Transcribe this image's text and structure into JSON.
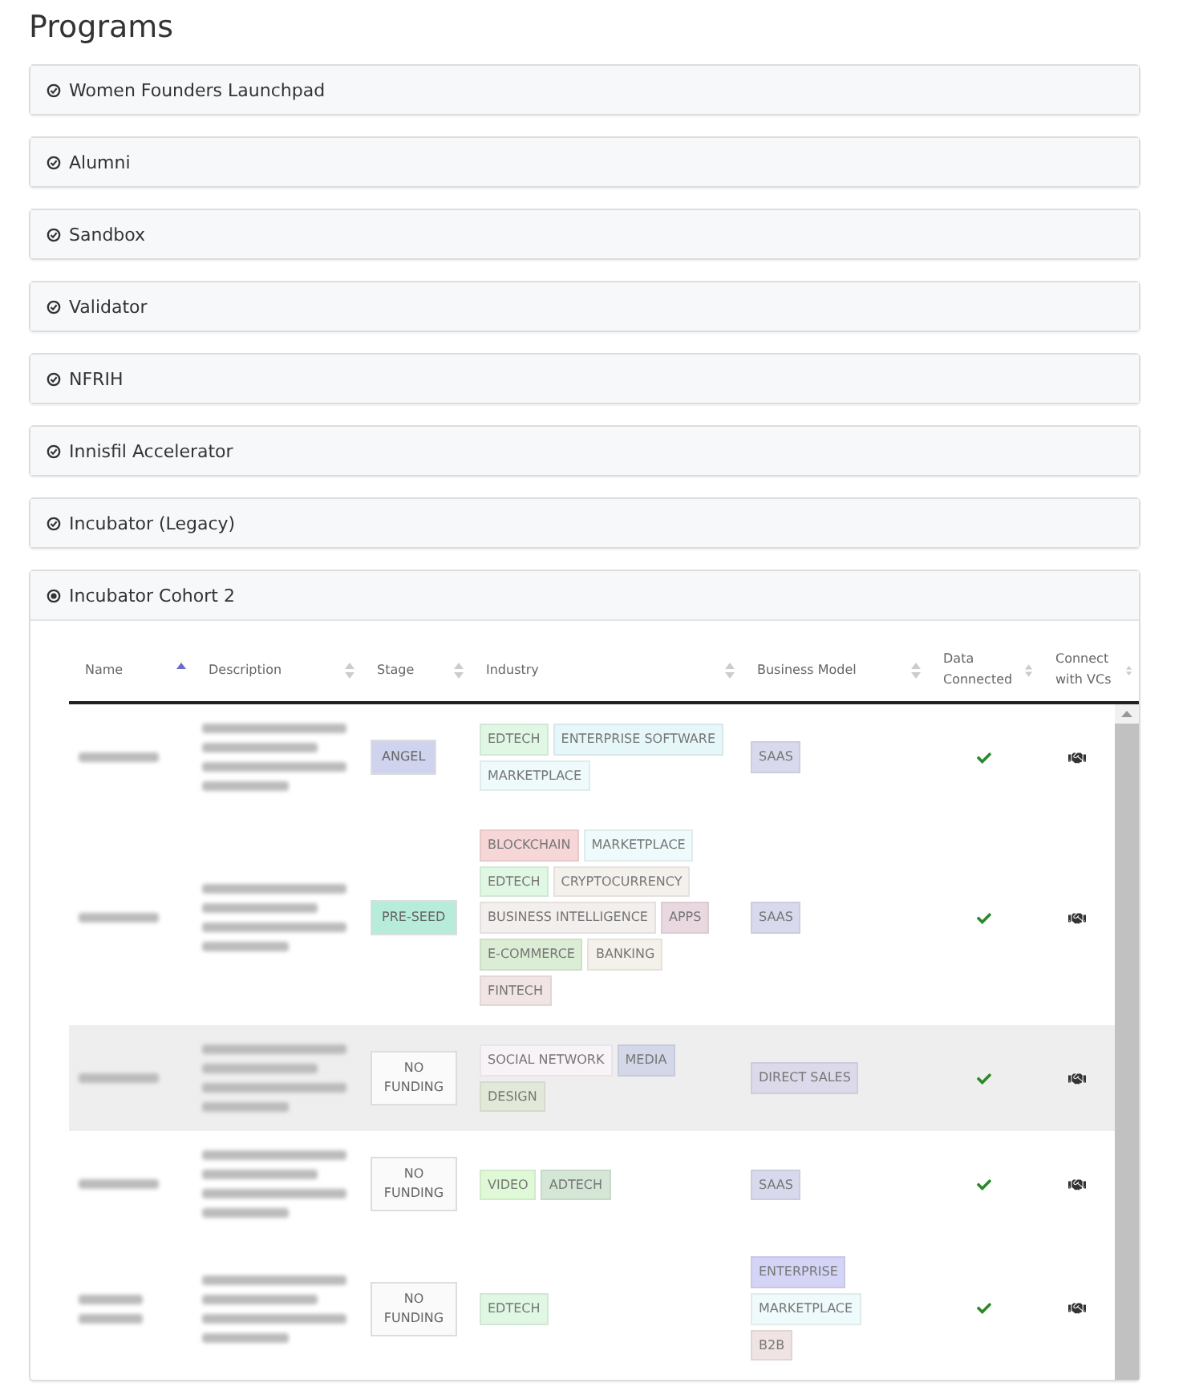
{
  "title": "Programs",
  "programs": [
    {
      "name": "Women Founders Launchpad",
      "expanded": false
    },
    {
      "name": "Alumni",
      "expanded": false
    },
    {
      "name": "Sandbox",
      "expanded": false
    },
    {
      "name": "Validator",
      "expanded": false
    },
    {
      "name": "NFRIH",
      "expanded": false
    },
    {
      "name": "Innisfil Accelerator",
      "expanded": false
    },
    {
      "name": "Incubator (Legacy)",
      "expanded": false
    },
    {
      "name": "Incubator Cohort 2",
      "expanded": true
    }
  ],
  "table": {
    "columns": [
      {
        "label": "Name",
        "sorted": true
      },
      {
        "label": "Description",
        "sorted": false
      },
      {
        "label": "Stage",
        "sorted": false
      },
      {
        "label": "Industry",
        "sorted": false
      },
      {
        "label": "Business Model",
        "sorted": false
      },
      {
        "label": "Data Connected",
        "sorted": false
      },
      {
        "label": "Connect with VCs",
        "sorted": false
      }
    ],
    "rows": [
      {
        "highlighted": false,
        "stage": {
          "label": "ANGEL",
          "color": "#cfd3ee"
        },
        "industry": [
          {
            "label": "EDTECH",
            "color": "#dff7e3"
          },
          {
            "label": "ENTERPRISE SOFTWARE",
            "color": "#e6f7f9"
          },
          {
            "label": "MARKETPLACE",
            "color": "#eefafb"
          }
        ],
        "business_model": [
          {
            "label": "SAAS",
            "color": "#d8d9ec"
          }
        ],
        "data_connected": true
      },
      {
        "highlighted": false,
        "stage": {
          "label": "PRE-SEED",
          "color": "#b6ecd9"
        },
        "industry": [
          {
            "label": "BLOCKCHAIN",
            "color": "#f6d6d6"
          },
          {
            "label": "MARKETPLACE",
            "color": "#eefafb"
          },
          {
            "label": "EDTECH",
            "color": "#dff7e3"
          },
          {
            "label": "CRYPTOCURRENCY",
            "color": "#f4f1ec"
          },
          {
            "label": "BUSINESS INTELLIGENCE",
            "color": "#f3efed"
          },
          {
            "label": "APPS",
            "color": "#ead8e0"
          },
          {
            "label": "E-COMMERCE",
            "color": "#dcedd5"
          },
          {
            "label": "BANKING",
            "color": "#f4f1eb"
          },
          {
            "label": "FINTECH",
            "color": "#f1e4e4"
          }
        ],
        "business_model": [
          {
            "label": "SAAS",
            "color": "#d8d9ec"
          }
        ],
        "data_connected": true
      },
      {
        "highlighted": true,
        "stage": {
          "label": "NO FUNDING",
          "color": "#fafafa"
        },
        "industry": [
          {
            "label": "SOCIAL NETWORK",
            "color": "#f7f3f7"
          },
          {
            "label": "MEDIA",
            "color": "#d3d7e8"
          },
          {
            "label": "DESIGN",
            "color": "#e2e9d8"
          }
        ],
        "business_model": [
          {
            "label": "DIRECT SALES",
            "color": "#dcd9ea"
          }
        ],
        "data_connected": true
      },
      {
        "highlighted": false,
        "stage": {
          "label": "NO FUNDING",
          "color": "#fafafa"
        },
        "industry": [
          {
            "label": "VIDEO",
            "color": "#dff9d6"
          },
          {
            "label": "ADTECH",
            "color": "#d4e6d6"
          }
        ],
        "business_model": [
          {
            "label": "SAAS",
            "color": "#d8d9ec"
          }
        ],
        "data_connected": true
      },
      {
        "highlighted": false,
        "stage": {
          "label": "NO FUNDING",
          "color": "#fafafa"
        },
        "industry": [
          {
            "label": "EDTECH",
            "color": "#dff7e3"
          }
        ],
        "business_model": [
          {
            "label": "ENTERPRISE",
            "color": "#d4d4f6"
          },
          {
            "label": "MARKETPLACE",
            "color": "#eefafb"
          },
          {
            "label": "B2B",
            "color": "#efe3e3"
          }
        ],
        "data_connected": true
      }
    ]
  }
}
